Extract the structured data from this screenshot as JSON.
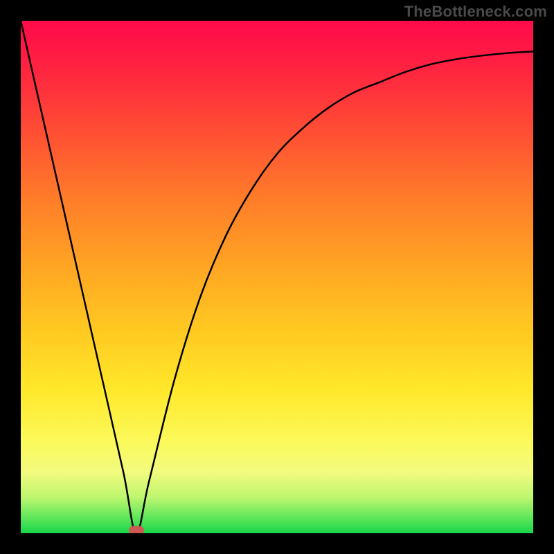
{
  "watermark": "TheBottleneck.com",
  "colors": {
    "frame_bg": "#000000",
    "curve": "#000000",
    "marker": "#cc5a54",
    "watermark_text": "#4a4a4a"
  },
  "chart_data": {
    "type": "line",
    "title": "",
    "xlabel": "",
    "ylabel": "",
    "xlim": [
      0,
      100
    ],
    "ylim": [
      0,
      100
    ],
    "grid": false,
    "note": "gradient background encodes y-value (red high → green low); curve depicts bottleneck mismatch dropping to a minimum then rising asymptotically",
    "series": [
      {
        "name": "bottleneck-curve",
        "x": [
          0,
          5,
          10,
          15,
          20,
          22.5,
          25,
          30,
          35,
          40,
          45,
          50,
          55,
          60,
          65,
          70,
          75,
          80,
          85,
          90,
          95,
          100
        ],
        "y": [
          100,
          78,
          56,
          34,
          12,
          0,
          10,
          30,
          46,
          58,
          67,
          74,
          79,
          83,
          86,
          88,
          90,
          91.5,
          92.5,
          93.2,
          93.7,
          94
        ]
      }
    ],
    "marker": {
      "x": 22.5,
      "y": 0,
      "label": "optimal-point"
    },
    "gradient_stops": [
      {
        "pos": 0,
        "color": "#ff0a4a"
      },
      {
        "pos": 8,
        "color": "#ff1f42"
      },
      {
        "pos": 22,
        "color": "#ff4f33"
      },
      {
        "pos": 35,
        "color": "#ff7d29"
      },
      {
        "pos": 48,
        "color": "#ffa523"
      },
      {
        "pos": 60,
        "color": "#ffc821"
      },
      {
        "pos": 72,
        "color": "#ffe82a"
      },
      {
        "pos": 82,
        "color": "#fbf95a"
      },
      {
        "pos": 88,
        "color": "#f3fb7e"
      },
      {
        "pos": 93,
        "color": "#bef66f"
      },
      {
        "pos": 97,
        "color": "#5de65a"
      },
      {
        "pos": 100,
        "color": "#18d64a"
      }
    ]
  }
}
